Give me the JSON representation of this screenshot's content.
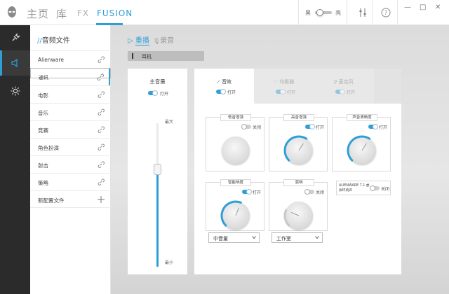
{
  "nav": {
    "home": "主页",
    "library": "库",
    "fx": "FX",
    "fusion": "FUSION"
  },
  "theme": {
    "dark": "黑",
    "light": "亮"
  },
  "window": {
    "minimize": "—",
    "maximize": "□",
    "close": "✕"
  },
  "profiles": {
    "title_prefix": "//",
    "title": "音频文件",
    "items": [
      "Alienware",
      "通讯",
      "电影",
      "音乐",
      "竞赛",
      "角色扮演",
      "射击",
      "策略"
    ],
    "selected_index": 1,
    "new_label": "新配置文件"
  },
  "tabs": {
    "playback": "重播",
    "record": "录音"
  },
  "device": "耳机",
  "volume": {
    "title": "主音量",
    "toggle_label": "打开",
    "toggle_on": true,
    "max_label": "最大",
    "min_label": "最小",
    "level": 0.68
  },
  "fx_tabs": {
    "effects": "音效",
    "equalizer": "均衡器",
    "mic": "麦克风",
    "effects_state": "打开",
    "equalizer_state": "打开",
    "mic_state": "打开"
  },
  "cards": {
    "bass": {
      "title": "低音增强",
      "state": "关闭",
      "on": false,
      "level": 0.0
    },
    "treble": {
      "title": "高音增强",
      "state": "打开",
      "on": true,
      "level": 0.62
    },
    "voice": {
      "title": "声音清晰度",
      "state": "打开",
      "on": true,
      "level": 0.62
    },
    "smartvol": {
      "title": "智能响度",
      "state": "打开",
      "on": true,
      "level": 0.58,
      "option": "中音量"
    },
    "reverb": {
      "title": "混响",
      "state": "关闭",
      "on": false,
      "level": 0.25,
      "option": "工作室"
    },
    "aw71": {
      "line1": "ALIENWARE 7.1 虚",
      "line2": "拟环绕声",
      "state": "关闭",
      "on": false
    }
  },
  "colors": {
    "accent": "#2f9fd6"
  }
}
